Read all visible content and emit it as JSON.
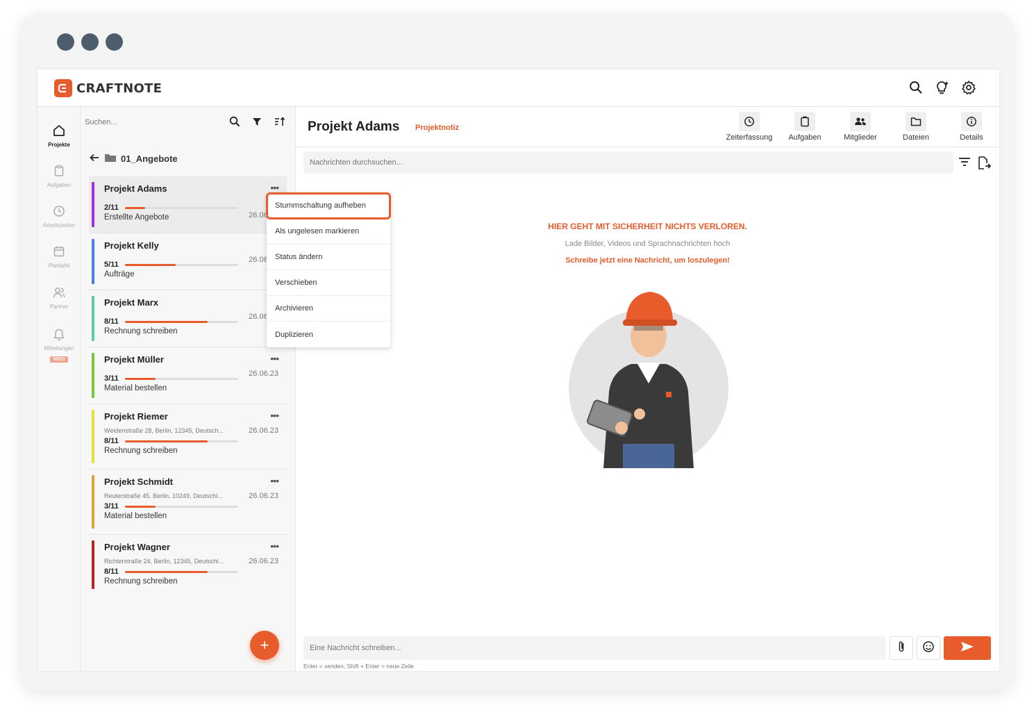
{
  "brand": {
    "name": "CRAFTNOTE"
  },
  "rail": {
    "items": [
      {
        "label": "Projekte",
        "active": true
      },
      {
        "label": "Aufgaben"
      },
      {
        "label": "Arbeitszeiten"
      },
      {
        "label": "Plantafel"
      },
      {
        "label": "Partner"
      },
      {
        "label": "Mitteilungen",
        "badge": "NEU!"
      }
    ]
  },
  "list": {
    "search_placeholder": "Suchen...",
    "folder": "01_Angebote",
    "projects": [
      {
        "name": "Projekt Adams",
        "date": "26.06.23",
        "address": "",
        "progress_label": "2/11",
        "progress": 0.18,
        "status": "Erstellte Angebote",
        "color": "#a233d8"
      },
      {
        "name": "Projekt Kelly",
        "date": "26.06.23",
        "address": "",
        "progress_label": "5/11",
        "progress": 0.45,
        "status": "Aufträge",
        "color": "#4b7fe0"
      },
      {
        "name": "Projekt Marx",
        "date": "26.06.23",
        "address": "",
        "progress_label": "8/11",
        "progress": 0.73,
        "status": "Rechnung schreiben",
        "color": "#5ec9a7"
      },
      {
        "name": "Projekt Müller",
        "date": "26.06.23",
        "address": "",
        "progress_label": "3/11",
        "progress": 0.27,
        "status": "Material bestellen",
        "color": "#7cc63d"
      },
      {
        "name": "Projekt Riemer",
        "date": "26.06.23",
        "address": "Weidenstraße 28, Berlin, 12345, Deutsch...",
        "progress_label": "8/11",
        "progress": 0.73,
        "status": "Rechnung schreiben",
        "color": "#e8e03a"
      },
      {
        "name": "Projekt Schmidt",
        "date": "26.06.23",
        "address": "Reuterstraße 45, Berlin, 10249, Deutschl...",
        "progress_label": "3/11",
        "progress": 0.27,
        "status": "Material bestellen",
        "color": "#dfa33b"
      },
      {
        "name": "Projekt Wagner",
        "date": "26.06.23",
        "address": "Richterstraße 24, Berlin, 12345, Deutschl...",
        "progress_label": "8/11",
        "progress": 0.73,
        "status": "Rechnung schreiben",
        "color": "#b8252f"
      }
    ],
    "fab_label": "+"
  },
  "context_menu": {
    "items": [
      "Stummschaltung aufheben",
      "Als ungelesen markieren",
      "Status ändern",
      "Verschieben",
      "Archivieren",
      "Duplizieren"
    ]
  },
  "main": {
    "title": "Projekt Adams",
    "tag": "Projektnotiz",
    "tabs": [
      {
        "label": "Zeiterfassung",
        "icon": "clock-icon"
      },
      {
        "label": "Aufgaben",
        "icon": "clipboard-icon"
      },
      {
        "label": "Mitglieder",
        "icon": "members-icon"
      },
      {
        "label": "Dateien",
        "icon": "folder-icon"
      },
      {
        "label": "Details",
        "icon": "info-icon"
      }
    ],
    "search_placeholder": "Nachrichten durchsuchen...",
    "empty_title": "HIER GEHT MIT SICHERHEIT NICHTS VERLOREN.",
    "empty_sub": "Lade Bilder, Videos und Sprachnachrichten hoch",
    "empty_cta": "Schreibe jetzt eine Nachricht, um loszulegen!",
    "compose_placeholder": "Eine Nachricht schreiben...",
    "compose_hint": "Enter = senden; Shift + Enter = neue Zeile"
  },
  "colors": {
    "accent": "#e85c2c"
  }
}
